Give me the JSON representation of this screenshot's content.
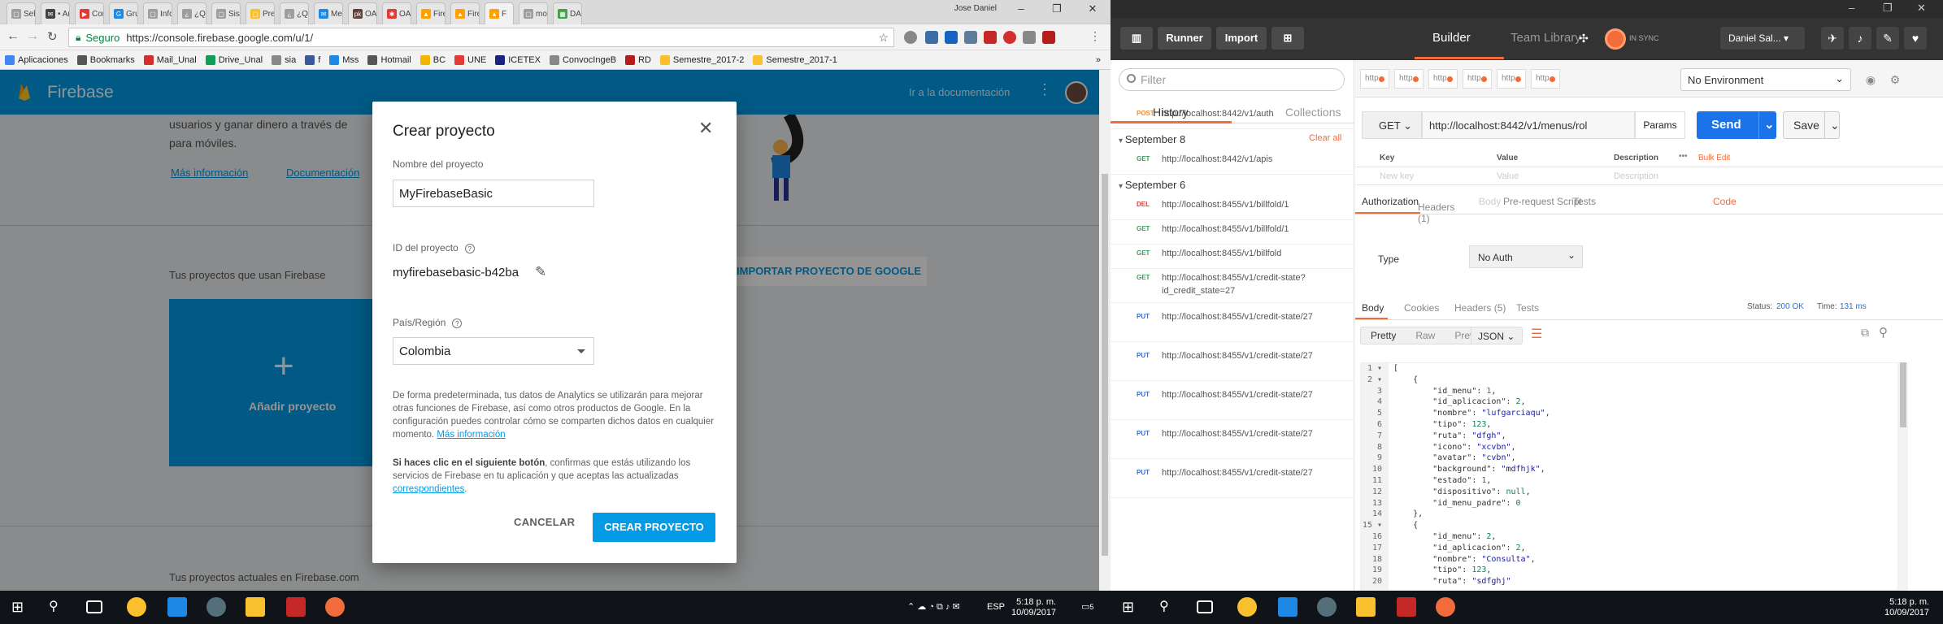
{
  "chrome": {
    "tabs": [
      "Selec",
      "• Au",
      "Cons",
      "Grup",
      "Infor",
      "¿Qu",
      "Siste",
      "Prese",
      "¿Qu",
      "Mes",
      "OAu",
      "OAu",
      "Fireb",
      "Fireb",
      "F",
      "mov",
      "DAD"
    ],
    "tab_letters": [
      "▢",
      "✉",
      "▶",
      "G",
      "▢",
      "¿",
      "▢",
      "▢",
      "¿",
      "✉",
      "pk",
      "✱",
      "▲",
      "▲",
      "▲",
      "▢",
      "▦"
    ],
    "profile": "Jose Daniel",
    "window_controls": [
      "–",
      "❐",
      "✕"
    ],
    "secure_label": "Seguro",
    "url": "https://console.firebase.google.com/u/1/",
    "bookmarks": [
      "Aplicaciones",
      "Bookmarks",
      "Mail_Unal",
      "Drive_Unal",
      "sia",
      "f",
      "Mss",
      "Hotmail",
      "BC",
      "UNE",
      "ICETEX",
      "ConvocIngeB",
      "RD",
      "Semestre_2017-2",
      "Semestre_2017-1"
    ],
    "more": "»"
  },
  "firebase": {
    "title": "Firebase",
    "docs_link": "Ir a la documentación",
    "intro_line1": "usuarios y ganar dinero a través de",
    "intro_line2": "para móviles.",
    "more_info": "Más información",
    "documentation": "Documentación",
    "your_projects": "Tus proyectos que usan Firebase",
    "import_button": "IMPORTAR PROYECTO DE GOOGLE",
    "add_project": "Añadir proyecto",
    "current_projects": "Tus proyectos actuales en Firebase.com"
  },
  "dialog": {
    "title": "Crear proyecto",
    "name_label": "Nombre del proyecto",
    "name_value": "MyFirebaseBasic",
    "id_label": "ID del proyecto",
    "id_value": "myfirebasebasic-b42ba",
    "region_label": "País/Región",
    "region_value": "Colombia",
    "notice1": "De forma predeterminada, tus datos de Analytics se utilizarán para mejorar otras funciones de Firebase, así como otros productos de Google. En la configuración puedes controlar cómo se comparten dichos datos en cualquier momento.",
    "notice1_link": "Más información",
    "notice2_bold": "Si haces clic en el siguiente botón",
    "notice2": ", confirmas que estás utilizando los servicios de Firebase en tu aplicación y que aceptas las actualizadas",
    "notice2_link": "correspondientes",
    "cancel": "CANCELAR",
    "create": "CREAR PROYECTO"
  },
  "taskbar_left": {
    "lang": "ESP",
    "time": "5:18 p. m.",
    "date": "10/09/2017",
    "notif_count": "5"
  },
  "postman": {
    "runner": "Runner",
    "import": "Import",
    "builder": "Builder",
    "team_library": "Team Library",
    "sync": "IN SYNC",
    "user": "Daniel Sal...",
    "filter_placeholder": "Filter",
    "history_tab": "History",
    "collections_tab": "Collections",
    "clear_all": "Clear all",
    "request_tabs": [
      "http",
      "http",
      "http",
      "http",
      "http",
      "http"
    ],
    "environment": "No Environment",
    "method": "GET",
    "url": "http://localhost:8442/v1/menus/rol",
    "params": "Params",
    "send": "Send",
    "save": "Save",
    "kv_key": "Key",
    "kv_value": "Value",
    "kv_desc": "Description",
    "bulk_edit": "Bulk Edit",
    "new_key": "New key",
    "value_ph": "Value",
    "desc_ph": "Description",
    "req_subtabs": {
      "authorization": "Authorization",
      "headers": "Headers (1)",
      "body": "Body",
      "prerequest": "Pre-request Script",
      "tests": "Tests",
      "code": "Code"
    },
    "auth_type_label": "Type",
    "auth_type_value": "No Auth",
    "resp_tabs": {
      "body": "Body",
      "cookies": "Cookies",
      "headers": "Headers (5)",
      "tests": "Tests"
    },
    "status_label": "Status:",
    "status_value": "200 OK",
    "time_label": "Time:",
    "time_value": "131 ms",
    "fmt": {
      "pretty": "Pretty",
      "raw": "Raw",
      "preview": "Preview",
      "json": "JSON"
    },
    "history": [
      {
        "method": "POST",
        "url": "http://localhost:8442/v1/auth"
      },
      {
        "group": "September 8"
      },
      {
        "method": "GET",
        "url": "http://localhost:8442/v1/apis"
      },
      {
        "group": "September 6"
      },
      {
        "method": "DEL",
        "url": "http://localhost:8455/v1/billfold/1"
      },
      {
        "method": "GET",
        "url": "http://localhost:8455/v1/billfold/1"
      },
      {
        "method": "GET",
        "url": "http://localhost:8455/v1/billfold"
      },
      {
        "method": "GET",
        "url": "http://localhost:8455/v1/credit-state?id_credit_state=27"
      },
      {
        "method": "PUT",
        "url": "http://localhost:8455/v1/credit-state/27"
      },
      {
        "method": "PUT",
        "url": "http://localhost:8455/v1/credit-state/27"
      },
      {
        "method": "PUT",
        "url": "http://localhost:8455/v1/credit-state/27"
      },
      {
        "method": "PUT",
        "url": "http://localhost:8455/v1/credit-state/27"
      },
      {
        "method": "PUT",
        "url": "http://localhost:8455/v1/credit-state/27"
      }
    ],
    "response_lines": [
      "[",
      "    {",
      "        \"id_menu\": 1,",
      "        \"id_aplicacion\": 2,",
      "        \"nombre\": \"lufgarciaqu\",",
      "        \"tipo\": 123,",
      "        \"ruta\": \"dfgh\",",
      "        \"icono\": \"xcvbn\",",
      "        \"avatar\": \"cvbn\",",
      "        \"background\": \"mdfhjk\",",
      "        \"estado\": 1,",
      "        \"dispositivo\": null,",
      "        \"id_menu_padre\": 0",
      "    },",
      "    {",
      "        \"id_menu\": 2,",
      "        \"id_aplicacion\": 2,",
      "        \"nombre\": \"Consulta\",",
      "        \"tipo\": 123,",
      "        \"ruta\": \"sdfghj\""
    ]
  },
  "taskbar_right": {
    "time": "5:18 p. m.",
    "date": "10/09/2017"
  },
  "colors": {
    "firebase_blue": "#039be5",
    "postman_orange": "#f26b3a",
    "send_blue": "#1a73e8",
    "get_green": "#37a05f",
    "put_blue": "#2f6fde",
    "del_red": "#e53935",
    "post_orange": "#f28b30"
  }
}
